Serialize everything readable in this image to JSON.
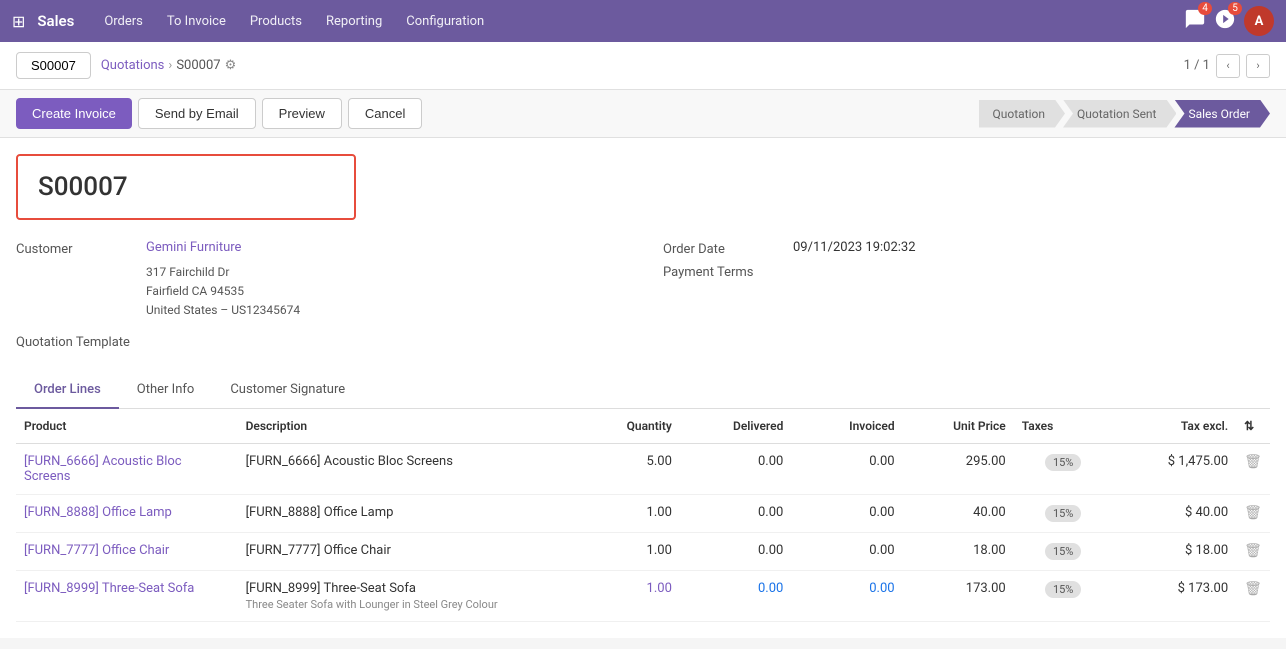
{
  "app": {
    "name": "Sales",
    "grid_icon": "⊞"
  },
  "nav": {
    "links": [
      "Orders",
      "To Invoice",
      "Products",
      "Reporting",
      "Configuration"
    ]
  },
  "notifications": {
    "messages_count": "4",
    "activity_count": "5"
  },
  "breadcrumb": {
    "parent": "Quotations",
    "current": "S00007",
    "record_nav": "1 / 1"
  },
  "toolbar": {
    "create_invoice": "Create Invoice",
    "send_by_email": "Send by Email",
    "preview": "Preview",
    "cancel": "Cancel"
  },
  "pipeline": {
    "steps": [
      "Quotation",
      "Quotation Sent",
      "Sales Order"
    ],
    "active": "Sales Order"
  },
  "order": {
    "id": "S00007",
    "customer_label": "Customer",
    "customer_name": "Gemini Furniture",
    "customer_address_line1": "317 Fairchild Dr",
    "customer_address_line2": "Fairfield CA 94535",
    "customer_address_line3": "United States – US12345674",
    "order_date_label": "Order Date",
    "order_date_help": "?",
    "order_date_value": "09/11/2023 19:02:32",
    "payment_terms_label": "Payment Terms",
    "payment_terms_value": "",
    "quotation_template_label": "Quotation Template"
  },
  "tabs": [
    {
      "id": "order-lines",
      "label": "Order Lines",
      "active": true
    },
    {
      "id": "other-info",
      "label": "Other Info",
      "active": false
    },
    {
      "id": "customer-signature",
      "label": "Customer Signature",
      "active": false
    }
  ],
  "table": {
    "headers": [
      "Product",
      "Description",
      "Quantity",
      "Delivered",
      "Invoiced",
      "Unit Price",
      "Taxes",
      "Tax excl."
    ],
    "rows": [
      {
        "product": "[FURN_6666] Acoustic Bloc Screens",
        "description": "[FURN_6666] Acoustic Bloc Screens",
        "description_sub": "",
        "quantity": "5.00",
        "delivered": "0.00",
        "invoiced": "0.00",
        "unit_price": "295.00",
        "taxes": "15%",
        "tax_excl": "$ 1,475.00",
        "highlight": false,
        "highlight_blue": false
      },
      {
        "product": "[FURN_8888] Office Lamp",
        "description": "[FURN_8888] Office Lamp",
        "description_sub": "",
        "quantity": "1.00",
        "delivered": "0.00",
        "invoiced": "0.00",
        "unit_price": "40.00",
        "taxes": "15%",
        "tax_excl": "$ 40.00",
        "highlight": false,
        "highlight_blue": false
      },
      {
        "product": "[FURN_7777] Office Chair",
        "description": "[FURN_7777] Office Chair",
        "description_sub": "",
        "quantity": "1.00",
        "delivered": "0.00",
        "invoiced": "0.00",
        "unit_price": "18.00",
        "taxes": "15%",
        "tax_excl": "$ 18.00",
        "highlight": false,
        "highlight_blue": false
      },
      {
        "product": "[FURN_8999] Three-Seat Sofa",
        "description": "[FURN_8999] Three-Seat Sofa",
        "description_sub": "Three Seater Sofa with Lounger in Steel Grey Colour",
        "quantity": "1.00",
        "delivered": "0.00",
        "invoiced": "0.00",
        "unit_price": "173.00",
        "taxes": "15%",
        "tax_excl": "$ 173.00",
        "highlight": true,
        "highlight_blue": true
      }
    ]
  }
}
